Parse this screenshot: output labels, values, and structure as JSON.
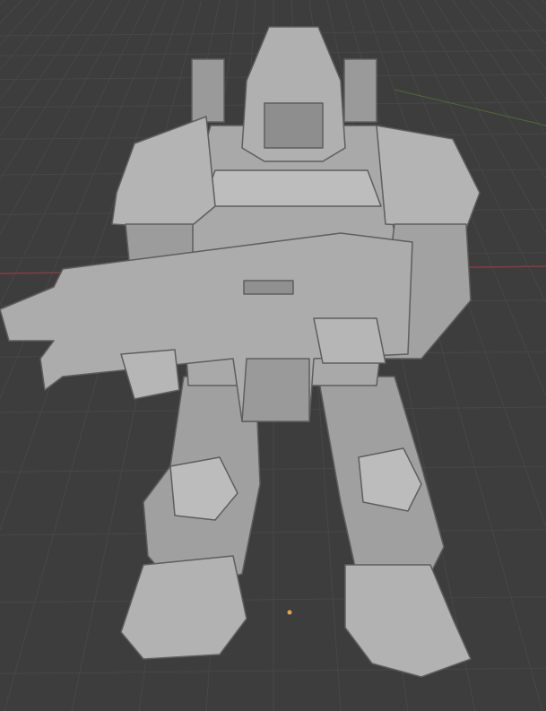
{
  "viewport": {
    "background_color": "#3d3d3d",
    "grid_color": "#4a4a4a",
    "x_axis_color": "#8a3a42",
    "y_axis_color": "#5a7a3a",
    "origin_color": "#f0a040",
    "model_color": "#a8a8a8",
    "model_shadow_color": "#6e6e6e",
    "model_highlight_color": "#d4d4d4"
  }
}
